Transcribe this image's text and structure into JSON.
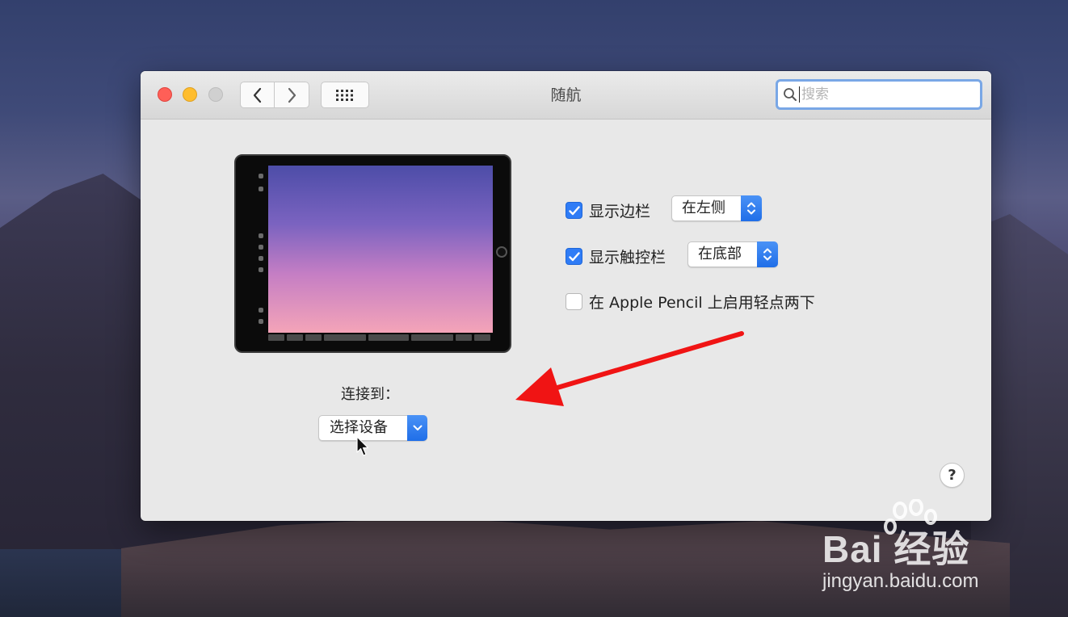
{
  "window": {
    "title": "随航",
    "search_placeholder": "搜索"
  },
  "options": {
    "show_sidebar": {
      "label": "显示边栏",
      "checked": true,
      "position": "在左侧"
    },
    "show_touchbar": {
      "label": "显示触控栏",
      "checked": true,
      "position": "在底部"
    },
    "double_tap_pencil": {
      "label": "在 Apple Pencil 上启用轻点两下",
      "checked": false
    }
  },
  "connect": {
    "label": "连接到：",
    "selected_device": "选择设备"
  },
  "help_label": "?",
  "icons": {
    "back": "chevron-left-icon",
    "forward": "chevron-right-icon",
    "grid": "grid-icon",
    "search": "magnifier-icon"
  },
  "colors": {
    "accent": "#2f7cf6",
    "annotation_arrow": "#f01414"
  },
  "watermark": {
    "brand": "Bai 经验",
    "url": "jingyan.baidu.com"
  }
}
